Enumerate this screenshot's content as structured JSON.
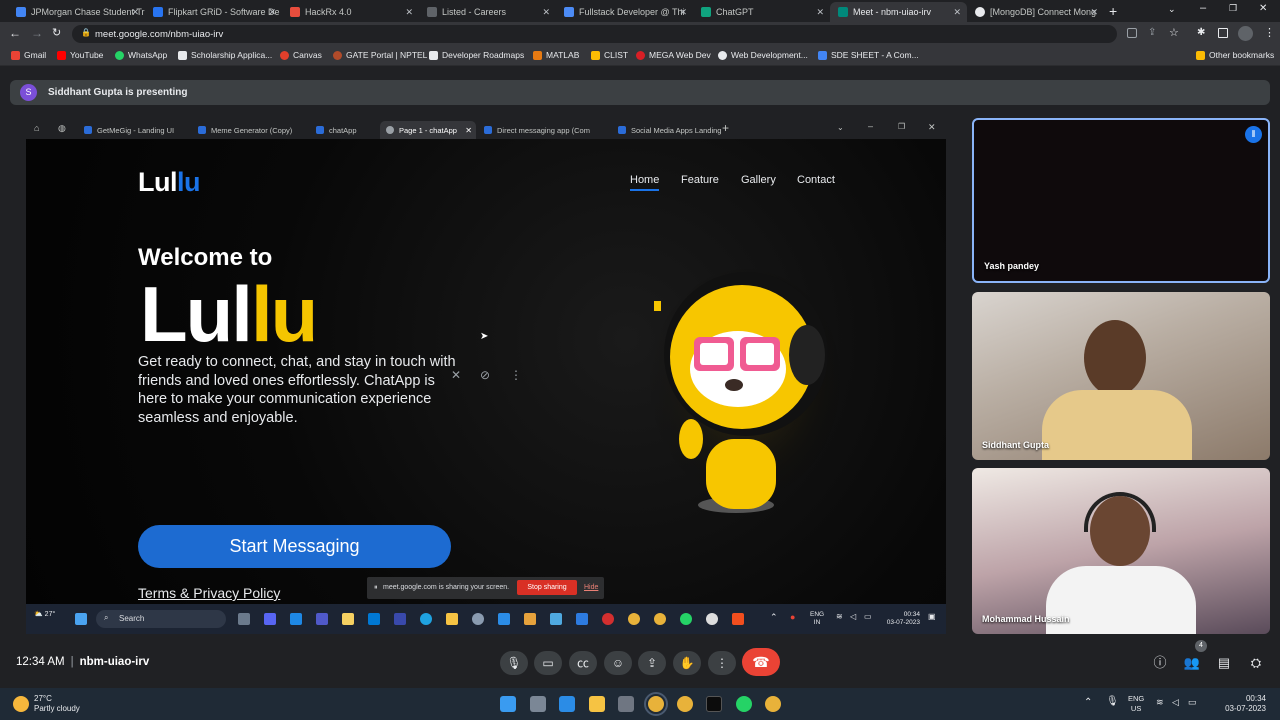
{
  "browser": {
    "tabs": [
      {
        "label": "JPMorgan Chase Student Tr",
        "color": "#4285f4"
      },
      {
        "label": "Flipkart GRiD - Software De",
        "color": "#2874f0"
      },
      {
        "label": "HackRx 4.0",
        "color": "#e84d3d"
      },
      {
        "label": "Listed - Careers",
        "color": "#5f6368"
      },
      {
        "label": "Fullstack Developer @ Thi",
        "color": "#4c8bf5"
      },
      {
        "label": "ChatGPT",
        "color": "#10a37f"
      },
      {
        "label": "Meet - nbm-uiao-irv",
        "color": "#00897b"
      },
      {
        "label": "[MongoDB] Connect Mong",
        "color": "#e8eaed"
      }
    ],
    "url": "meet.google.com/nbm-uiao-irv",
    "bookmarks": [
      {
        "label": "Gmail",
        "color": "#ea4335"
      },
      {
        "label": "YouTube",
        "color": "#ff0000"
      },
      {
        "label": "WhatsApp",
        "color": "#25d366"
      },
      {
        "label": "Scholarship Applica...",
        "color": "#e8eaed"
      },
      {
        "label": "Canvas",
        "color": "#e13f2b"
      },
      {
        "label": "GATE Portal | NPTEL",
        "color": "#b04b2a"
      },
      {
        "label": "Developer Roadmaps",
        "color": "#e8eaed"
      },
      {
        "label": "MATLAB",
        "color": "#e67a12"
      },
      {
        "label": "CLIST",
        "color": "#fbbc04"
      },
      {
        "label": "MEGA Web Dev",
        "color": "#d81f26"
      },
      {
        "label": "Web Development...",
        "color": "#e8eaed"
      },
      {
        "label": "SDE SHEET - A Com...",
        "color": "#4285f4"
      }
    ],
    "other_bookmarks": "Other bookmarks"
  },
  "meet": {
    "presenter_initial": "S",
    "presenting_text": "Siddhant Gupta is presenting",
    "participants": [
      "Yash pandey",
      "Siddhant Gupta",
      "Mohammad Hussain"
    ],
    "time": "12:34 AM",
    "meeting_code": "nbm-uiao-irv",
    "people_count": "4"
  },
  "shared_screen": {
    "tabs": [
      "GetMeGig - Landing UI",
      "Meme Generator (Copy)",
      "chatApp",
      "Page 1 - chatApp",
      "Direct messaging app (Com",
      "Social Media Apps Landing"
    ],
    "site": {
      "brand_part1": "Lul",
      "brand_part2": "lu",
      "nav": [
        "Home",
        "Feature",
        "Gallery",
        "Contact"
      ],
      "welcome": "Welcome to",
      "big_part1": "Lul",
      "big_part2": "lu",
      "description": "Get ready to connect, chat, and stay in touch with friends and loved ones effortlessly. ChatApp is here to make your communication experience seamless and enjoyable.",
      "cta": "Start Messaging",
      "terms": "Terms & Privacy Policy"
    },
    "share_notice": "meet.google.com is sharing your screen.",
    "stop_sharing": "Stop sharing",
    "hide": "Hide",
    "taskbar": {
      "weather": "27°",
      "search": "Search",
      "lang_top": "ENG",
      "lang_bottom": "IN",
      "time": "00:34",
      "date": "03-07-2023"
    }
  },
  "host_taskbar": {
    "temp": "27°C",
    "condition": "Partly cloudy",
    "lang_top": "ENG",
    "lang_bottom": "US",
    "time": "00:34",
    "date": "03-07-2023"
  },
  "colors": {
    "accent_blue": "#1a73e8",
    "brand_yellow": "#f5c500",
    "end_call_red": "#ea4335",
    "active_speaker_border": "#8ab4f8"
  }
}
